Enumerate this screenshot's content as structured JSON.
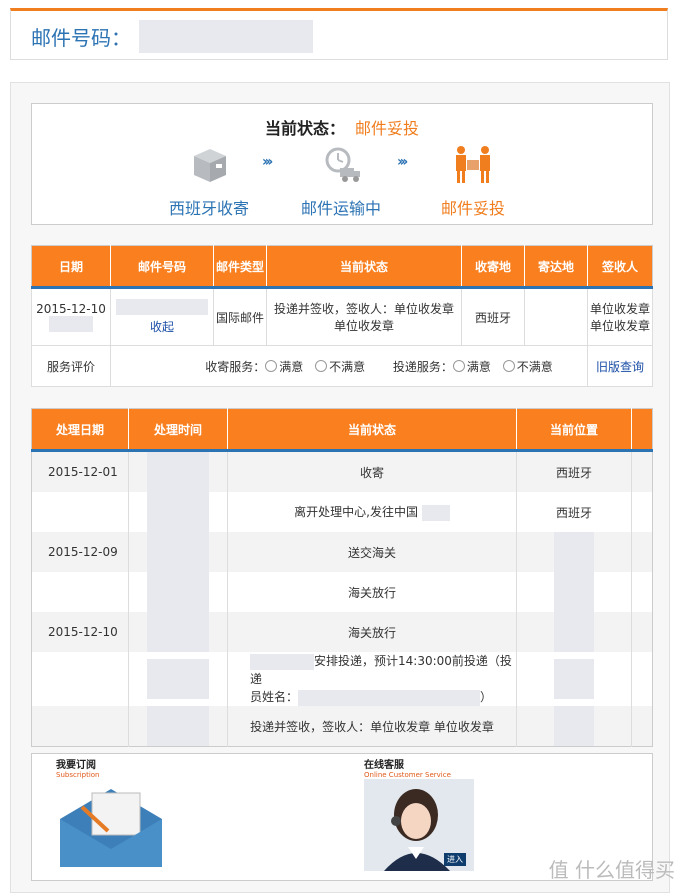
{
  "header": {
    "title": "邮件号码："
  },
  "status": {
    "label": "当前状态：",
    "value": "邮件妥投",
    "steps": [
      {
        "label": "西班牙收寄",
        "icon": "box-icon"
      },
      {
        "label": "邮件运输中",
        "icon": "truck-clock-icon"
      },
      {
        "label": "邮件妥投",
        "icon": "delivery-person-icon"
      }
    ],
    "colors": {
      "accent": "#f07d1e",
      "blue": "#2c73b4"
    }
  },
  "summary": {
    "headers": [
      "日期",
      "邮件号码",
      "邮件类型",
      "当前状态",
      "收寄地",
      "寄达地",
      "签收人"
    ],
    "row": {
      "date": "2015-12-10",
      "collapse": "收起",
      "type": "国际邮件",
      "state": "投递并签收，签收人：单位收发章 单位收发章",
      "origin": "西班牙",
      "dest": "",
      "signer": "单位收发章 单位收发章"
    },
    "rating": {
      "label": "服务评价",
      "collect_label": "收寄服务：",
      "deliver_label": "投递服务：",
      "satisfied": "满意",
      "unsatisfied": "不满意",
      "old_query": "旧版查询"
    }
  },
  "history": {
    "headers": [
      "处理日期",
      "处理时间",
      "当前状态",
      "当前位置"
    ],
    "rows": [
      {
        "date": "2015-12-01",
        "status": "收寄",
        "location": "西班牙"
      },
      {
        "date": "",
        "status": "离开处理中心,发往中国",
        "location": "西班牙"
      },
      {
        "date": "2015-12-09",
        "status": "送交海关",
        "location": ""
      },
      {
        "date": "",
        "status": "海关放行",
        "location": ""
      },
      {
        "date": "2015-12-10",
        "status": "海关放行",
        "location": ""
      },
      {
        "date": "",
        "status_a": "安排投递，预计14:30:00前投递（投递",
        "status_b": "员姓名：",
        "status_c": "）",
        "location": ""
      },
      {
        "date": "",
        "status": "投递并签收，签收人：单位收发章 单位收发章",
        "location": ""
      }
    ]
  },
  "promos": {
    "subscribe": {
      "title": "我要订阅",
      "sub": "Subscription"
    },
    "service": {
      "title": "在线客服",
      "sub": "Online Customer Service",
      "enter": "进入"
    }
  },
  "watermark": "值 什么值得买"
}
